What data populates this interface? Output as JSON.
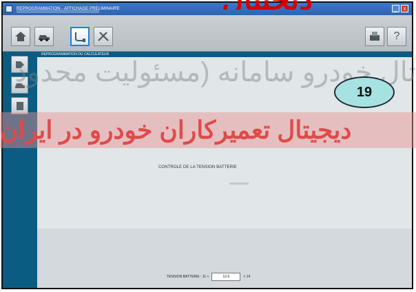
{
  "window": {
    "title": "REPROGRAMMATION - AFFICHAGE PRELIMINAIRE",
    "minimize_glyph": "_",
    "close_glyph": "x"
  },
  "toolbar": {
    "left_buttons": [
      {
        "icon": "home-icon"
      },
      {
        "icon": "vehicle-icon"
      },
      {
        "icon": "connector-icon",
        "active": true
      },
      {
        "icon": "tools-icon"
      }
    ],
    "right_buttons": [
      {
        "icon": "printer-icon"
      },
      {
        "icon": "help-icon",
        "glyph": "?"
      }
    ]
  },
  "sidebar": {
    "items": [
      {
        "icon": "tag-icon"
      },
      {
        "icon": "car-icon"
      },
      {
        "icon": "document-icon"
      }
    ]
  },
  "content": {
    "header": "REPROGRAMMATION DU CALCULATEUR",
    "check_title": "CONTROLE DE LA TENSION BATTERIE",
    "voltage": {
      "label": "TENSION BATTERIE : 11 <",
      "value": "12.6",
      "upper": "< 14"
    }
  },
  "annotation": {
    "step_number": "19"
  },
  "watermarks": {
    "top_logo": "دیجیتال",
    "line1": "تال خودرو سامانه (مسئولیت محدود",
    "line2": "دیجیتال تعمیرکاران خودرو در ایران"
  },
  "colors": {
    "sidebar": "#0b5c82",
    "titlebar": "#3a78c8",
    "badge_fill": "#a7e2e2",
    "watermark_red": "#e04a4a"
  }
}
